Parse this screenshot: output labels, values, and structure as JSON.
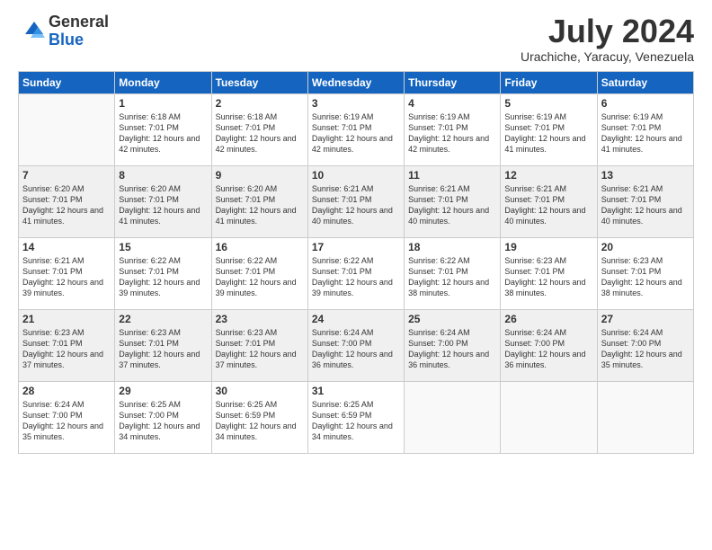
{
  "logo": {
    "general": "General",
    "blue": "Blue"
  },
  "title": "July 2024",
  "location": "Urachiche, Yaracuy, Venezuela",
  "weekdays": [
    "Sunday",
    "Monday",
    "Tuesday",
    "Wednesday",
    "Thursday",
    "Friday",
    "Saturday"
  ],
  "weeks": [
    [
      {
        "day": "",
        "sunrise": "",
        "sunset": "",
        "daylight": ""
      },
      {
        "day": "1",
        "sunrise": "Sunrise: 6:18 AM",
        "sunset": "Sunset: 7:01 PM",
        "daylight": "Daylight: 12 hours and 42 minutes."
      },
      {
        "day": "2",
        "sunrise": "Sunrise: 6:18 AM",
        "sunset": "Sunset: 7:01 PM",
        "daylight": "Daylight: 12 hours and 42 minutes."
      },
      {
        "day": "3",
        "sunrise": "Sunrise: 6:19 AM",
        "sunset": "Sunset: 7:01 PM",
        "daylight": "Daylight: 12 hours and 42 minutes."
      },
      {
        "day": "4",
        "sunrise": "Sunrise: 6:19 AM",
        "sunset": "Sunset: 7:01 PM",
        "daylight": "Daylight: 12 hours and 42 minutes."
      },
      {
        "day": "5",
        "sunrise": "Sunrise: 6:19 AM",
        "sunset": "Sunset: 7:01 PM",
        "daylight": "Daylight: 12 hours and 41 minutes."
      },
      {
        "day": "6",
        "sunrise": "Sunrise: 6:19 AM",
        "sunset": "Sunset: 7:01 PM",
        "daylight": "Daylight: 12 hours and 41 minutes."
      }
    ],
    [
      {
        "day": "7",
        "sunrise": "Sunrise: 6:20 AM",
        "sunset": "Sunset: 7:01 PM",
        "daylight": "Daylight: 12 hours and 41 minutes."
      },
      {
        "day": "8",
        "sunrise": "Sunrise: 6:20 AM",
        "sunset": "Sunset: 7:01 PM",
        "daylight": "Daylight: 12 hours and 41 minutes."
      },
      {
        "day": "9",
        "sunrise": "Sunrise: 6:20 AM",
        "sunset": "Sunset: 7:01 PM",
        "daylight": "Daylight: 12 hours and 41 minutes."
      },
      {
        "day": "10",
        "sunrise": "Sunrise: 6:21 AM",
        "sunset": "Sunset: 7:01 PM",
        "daylight": "Daylight: 12 hours and 40 minutes."
      },
      {
        "day": "11",
        "sunrise": "Sunrise: 6:21 AM",
        "sunset": "Sunset: 7:01 PM",
        "daylight": "Daylight: 12 hours and 40 minutes."
      },
      {
        "day": "12",
        "sunrise": "Sunrise: 6:21 AM",
        "sunset": "Sunset: 7:01 PM",
        "daylight": "Daylight: 12 hours and 40 minutes."
      },
      {
        "day": "13",
        "sunrise": "Sunrise: 6:21 AM",
        "sunset": "Sunset: 7:01 PM",
        "daylight": "Daylight: 12 hours and 40 minutes."
      }
    ],
    [
      {
        "day": "14",
        "sunrise": "Sunrise: 6:21 AM",
        "sunset": "Sunset: 7:01 PM",
        "daylight": "Daylight: 12 hours and 39 minutes."
      },
      {
        "day": "15",
        "sunrise": "Sunrise: 6:22 AM",
        "sunset": "Sunset: 7:01 PM",
        "daylight": "Daylight: 12 hours and 39 minutes."
      },
      {
        "day": "16",
        "sunrise": "Sunrise: 6:22 AM",
        "sunset": "Sunset: 7:01 PM",
        "daylight": "Daylight: 12 hours and 39 minutes."
      },
      {
        "day": "17",
        "sunrise": "Sunrise: 6:22 AM",
        "sunset": "Sunset: 7:01 PM",
        "daylight": "Daylight: 12 hours and 39 minutes."
      },
      {
        "day": "18",
        "sunrise": "Sunrise: 6:22 AM",
        "sunset": "Sunset: 7:01 PM",
        "daylight": "Daylight: 12 hours and 38 minutes."
      },
      {
        "day": "19",
        "sunrise": "Sunrise: 6:23 AM",
        "sunset": "Sunset: 7:01 PM",
        "daylight": "Daylight: 12 hours and 38 minutes."
      },
      {
        "day": "20",
        "sunrise": "Sunrise: 6:23 AM",
        "sunset": "Sunset: 7:01 PM",
        "daylight": "Daylight: 12 hours and 38 minutes."
      }
    ],
    [
      {
        "day": "21",
        "sunrise": "Sunrise: 6:23 AM",
        "sunset": "Sunset: 7:01 PM",
        "daylight": "Daylight: 12 hours and 37 minutes."
      },
      {
        "day": "22",
        "sunrise": "Sunrise: 6:23 AM",
        "sunset": "Sunset: 7:01 PM",
        "daylight": "Daylight: 12 hours and 37 minutes."
      },
      {
        "day": "23",
        "sunrise": "Sunrise: 6:23 AM",
        "sunset": "Sunset: 7:01 PM",
        "daylight": "Daylight: 12 hours and 37 minutes."
      },
      {
        "day": "24",
        "sunrise": "Sunrise: 6:24 AM",
        "sunset": "Sunset: 7:00 PM",
        "daylight": "Daylight: 12 hours and 36 minutes."
      },
      {
        "day": "25",
        "sunrise": "Sunrise: 6:24 AM",
        "sunset": "Sunset: 7:00 PM",
        "daylight": "Daylight: 12 hours and 36 minutes."
      },
      {
        "day": "26",
        "sunrise": "Sunrise: 6:24 AM",
        "sunset": "Sunset: 7:00 PM",
        "daylight": "Daylight: 12 hours and 36 minutes."
      },
      {
        "day": "27",
        "sunrise": "Sunrise: 6:24 AM",
        "sunset": "Sunset: 7:00 PM",
        "daylight": "Daylight: 12 hours and 35 minutes."
      }
    ],
    [
      {
        "day": "28",
        "sunrise": "Sunrise: 6:24 AM",
        "sunset": "Sunset: 7:00 PM",
        "daylight": "Daylight: 12 hours and 35 minutes."
      },
      {
        "day": "29",
        "sunrise": "Sunrise: 6:25 AM",
        "sunset": "Sunset: 7:00 PM",
        "daylight": "Daylight: 12 hours and 34 minutes."
      },
      {
        "day": "30",
        "sunrise": "Sunrise: 6:25 AM",
        "sunset": "Sunset: 6:59 PM",
        "daylight": "Daylight: 12 hours and 34 minutes."
      },
      {
        "day": "31",
        "sunrise": "Sunrise: 6:25 AM",
        "sunset": "Sunset: 6:59 PM",
        "daylight": "Daylight: 12 hours and 34 minutes."
      },
      {
        "day": "",
        "sunrise": "",
        "sunset": "",
        "daylight": ""
      },
      {
        "day": "",
        "sunrise": "",
        "sunset": "",
        "daylight": ""
      },
      {
        "day": "",
        "sunrise": "",
        "sunset": "",
        "daylight": ""
      }
    ]
  ]
}
